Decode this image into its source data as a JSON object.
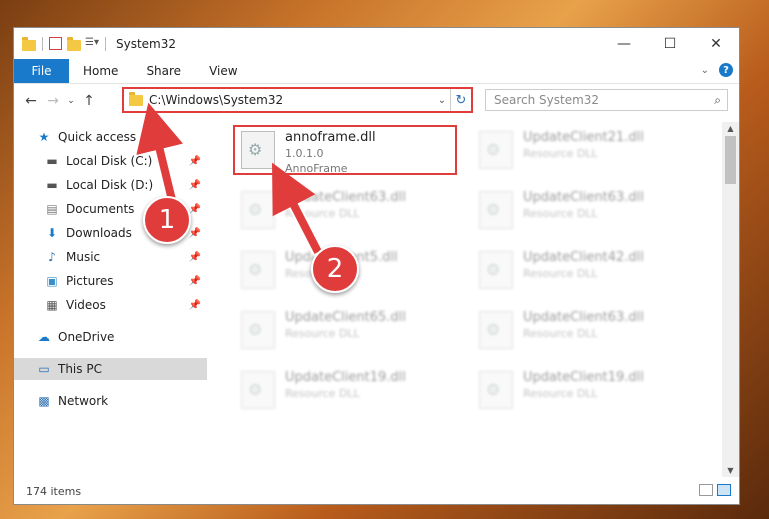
{
  "window": {
    "title": "System32"
  },
  "window_controls": {
    "minimize": "—",
    "maximize": "☐",
    "close": "✕"
  },
  "ribbon": {
    "file_tab": "File",
    "tabs": [
      "Home",
      "Share",
      "View"
    ],
    "help": "?"
  },
  "navbar": {
    "address": "C:\\Windows\\System32",
    "search_placeholder": "Search System32"
  },
  "sidebar": {
    "items": [
      {
        "label": "Quick access",
        "icon": "star-icon",
        "pinned": false
      },
      {
        "label": "Local Disk (C:)",
        "icon": "drive-icon",
        "pinned": true
      },
      {
        "label": "Local Disk (D:)",
        "icon": "drive-icon",
        "pinned": true
      },
      {
        "label": "Documents",
        "icon": "documents-icon",
        "pinned": true
      },
      {
        "label": "Downloads",
        "icon": "download-icon",
        "pinned": true
      },
      {
        "label": "Music",
        "icon": "music-icon",
        "pinned": true
      },
      {
        "label": "Pictures",
        "icon": "pictures-icon",
        "pinned": true
      },
      {
        "label": "Videos",
        "icon": "videos-icon",
        "pinned": true
      },
      {
        "label": "OneDrive",
        "icon": "cloud-icon",
        "pinned": false
      },
      {
        "label": "This PC",
        "icon": "computer-icon",
        "pinned": false,
        "selected": true
      },
      {
        "label": "Network",
        "icon": "network-icon",
        "pinned": false
      }
    ]
  },
  "files": [
    {
      "name": "annoframe.dll",
      "line1": "1.0.1.0",
      "line2": "AnnoFrame",
      "highlight": true
    },
    {
      "name": "UpdateClient21.dll",
      "line1": "Resource DLL",
      "blur": true
    },
    {
      "name": "UpdateClient63.dll",
      "line1": "Resource DLL",
      "blur": true
    },
    {
      "name": "UpdateClient63.dll",
      "line1": "Resource DLL",
      "blur": true
    },
    {
      "name": "UpdateClient5.dll",
      "line1": "Resource DLL",
      "blur": true
    },
    {
      "name": "UpdateClient42.dll",
      "line1": "Resource DLL",
      "blur": true
    },
    {
      "name": "UpdateClient65.dll",
      "line1": "Resource DLL",
      "blur": true
    },
    {
      "name": "UpdateClient63.dll",
      "line1": "Resource DLL",
      "blur": true
    },
    {
      "name": "UpdateClient19.dll",
      "line1": "Resource DLL",
      "blur": true
    },
    {
      "name": "UpdateClient19.dll",
      "line1": "Resource DLL",
      "blur": true
    }
  ],
  "status": {
    "items_count": "174 items"
  },
  "annotations": {
    "marker1": "1",
    "marker2": "2"
  },
  "colors": {
    "accent": "#1979ca",
    "highlight": "#e03c3c"
  }
}
